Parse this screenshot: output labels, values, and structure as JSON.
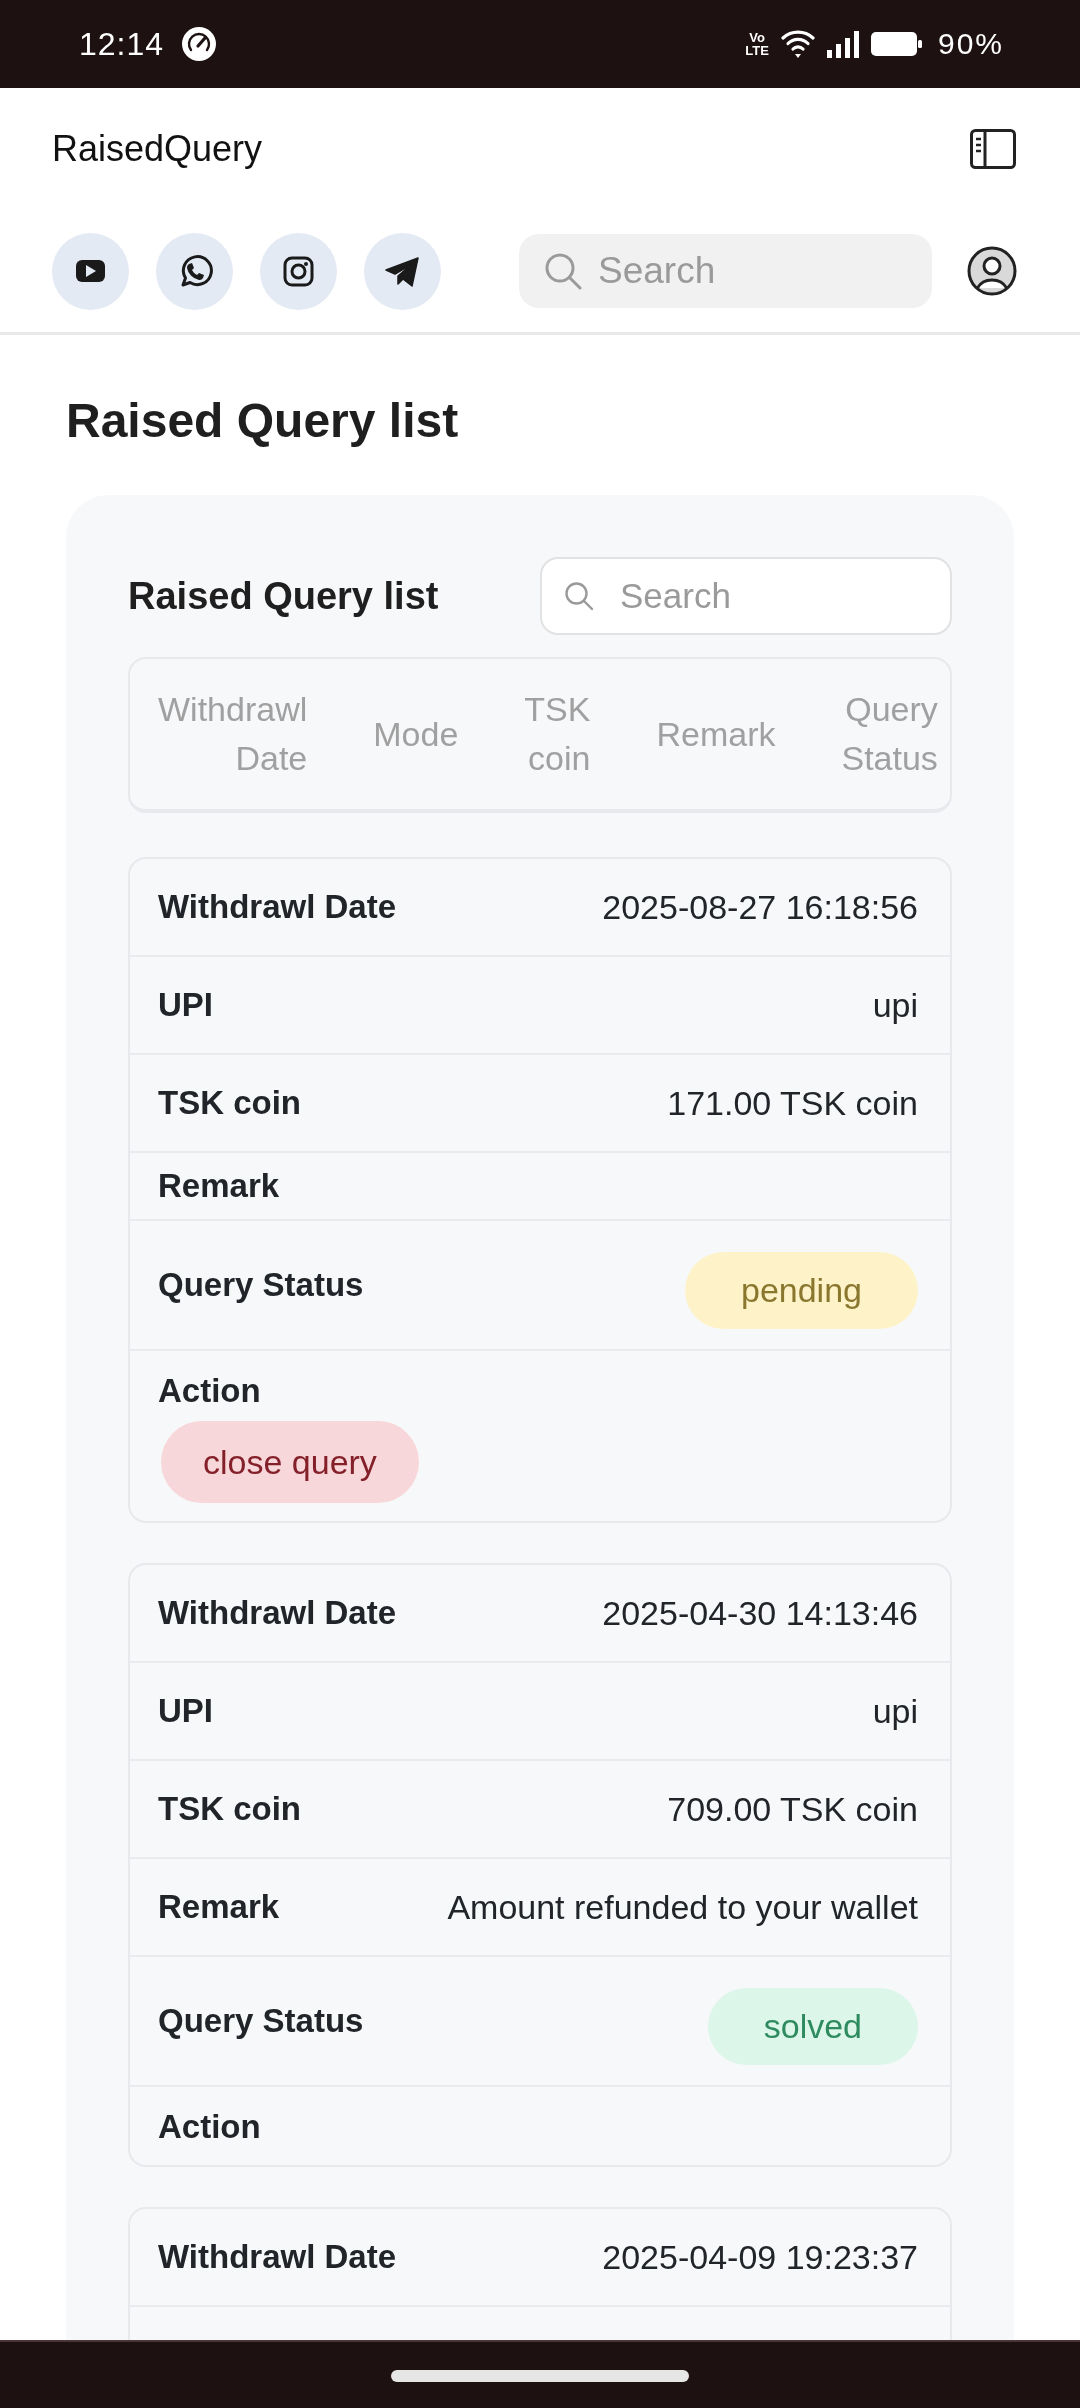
{
  "status_bar": {
    "time": "12:14",
    "network": [
      "Vo",
      "LTE"
    ],
    "battery": "90%"
  },
  "app_bar": {
    "title": "RaisedQuery",
    "search": {
      "placeholder": "Search"
    }
  },
  "page": {
    "title": "Raised Query list"
  },
  "list_card": {
    "title": "Raised Query list",
    "search": {
      "placeholder": "Search"
    },
    "table": {
      "columns": [
        "Withdrawl Date",
        "Mode",
        "TSK coin",
        "Remark",
        "Query Status"
      ]
    },
    "records": [
      {
        "fields": [
          {
            "kind": "text",
            "label": "Withdrawl Date",
            "value": "2025-08-27 16:18:56"
          },
          {
            "kind": "text",
            "label": "UPI",
            "value": "upi"
          },
          {
            "kind": "text",
            "label": "TSK coin",
            "value": "171.00 TSK coin"
          },
          {
            "kind": "text",
            "label": "Remark"
          },
          {
            "kind": "status",
            "label": "Query Status",
            "value": "pending",
            "color": "#fef3c8"
          },
          {
            "kind": "action",
            "label": "Action",
            "button": "close query"
          }
        ]
      },
      {
        "fields": [
          {
            "kind": "text",
            "label": "Withdrawl Date",
            "value": "2025-04-30 14:13:46"
          },
          {
            "kind": "text",
            "label": "UPI",
            "value": "upi"
          },
          {
            "kind": "text",
            "label": "TSK coin",
            "value": "709.00 TSK coin"
          },
          {
            "kind": "text",
            "label": "Remark",
            "value": "Amount refunded to your wallet"
          },
          {
            "kind": "status",
            "label": "Query Status",
            "value": "solved",
            "color": "#dcf6ea"
          },
          {
            "kind": "action",
            "label": "Action"
          }
        ]
      },
      {
        "fields": [
          {
            "kind": "text",
            "label": "Withdrawl Date",
            "value": "2025-04-09 19:23:37"
          }
        ]
      }
    ]
  }
}
